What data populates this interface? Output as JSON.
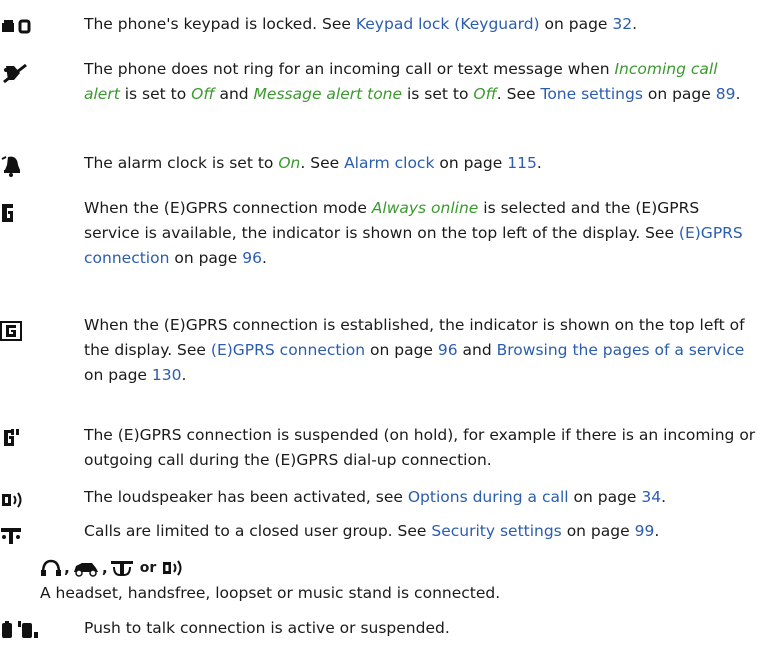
{
  "entries": [
    {
      "icon": "keypad-lock-icon",
      "parts": [
        {
          "t": "The phone's keypad is locked. See "
        },
        {
          "t": "Keypad lock (Keyguard)",
          "s": "link"
        },
        {
          "t": " on page "
        },
        {
          "t": "32",
          "s": "link"
        },
        {
          "t": "."
        }
      ]
    },
    {
      "icon": "silent-mode-icon",
      "parts": [
        {
          "t": "The phone does not ring for an incoming call or text message when "
        },
        {
          "t": "Incoming call alert",
          "s": "em"
        },
        {
          "t": " is set to "
        },
        {
          "t": "Off",
          "s": "em"
        },
        {
          "t": " and "
        },
        {
          "t": "Message alert tone",
          "s": "em"
        },
        {
          "t": " is set to "
        },
        {
          "t": "Off",
          "s": "em"
        },
        {
          "t": ". See "
        },
        {
          "t": "Tone settings",
          "s": "link"
        },
        {
          "t": " on page "
        },
        {
          "t": "89",
          "s": "link"
        },
        {
          "t": "."
        }
      ]
    },
    {
      "icon": "alarm-clock-icon",
      "parts": [
        {
          "t": "The alarm clock is set to "
        },
        {
          "t": "On",
          "s": "em"
        },
        {
          "t": ". See "
        },
        {
          "t": "Alarm clock",
          "s": "link"
        },
        {
          "t": " on page "
        },
        {
          "t": "115",
          "s": "link"
        },
        {
          "t": "."
        }
      ]
    },
    {
      "icon": "egprs-available-icon",
      "parts": [
        {
          "t": "When the (E)GPRS connection mode "
        },
        {
          "t": "Always online",
          "s": "em"
        },
        {
          "t": " is selected and the (E)GPRS service is available, the indicator is shown on the top left of the display. See "
        },
        {
          "t": "(E)GPRS connection",
          "s": "link"
        },
        {
          "t": " on page "
        },
        {
          "t": "96",
          "s": "link"
        },
        {
          "t": "."
        }
      ]
    },
    {
      "icon": "egprs-connected-icon",
      "parts": [
        {
          "t": "When the (E)GPRS connection is established, the indicator is shown on the top left of the display. See "
        },
        {
          "t": "(E)GPRS connection",
          "s": "link"
        },
        {
          "t": " on page "
        },
        {
          "t": "96",
          "s": "link"
        },
        {
          "t": " and "
        },
        {
          "t": "Browsing the pages of a service",
          "s": "link"
        },
        {
          "t": " on page "
        },
        {
          "t": "130",
          "s": "link"
        },
        {
          "t": "."
        }
      ]
    },
    {
      "icon": "egprs-suspended-icon",
      "parts": [
        {
          "t": "The (E)GPRS connection is suspended (on hold), for example if there is an incoming or outgoing call during the (E)GPRS dial-up connection."
        }
      ]
    },
    {
      "icon": "loudspeaker-icon",
      "parts": [
        {
          "t": "The loudspeaker has been activated, see "
        },
        {
          "t": "Options during a call",
          "s": "link"
        },
        {
          "t": " on page "
        },
        {
          "t": "34",
          "s": "link"
        },
        {
          "t": "."
        }
      ]
    },
    {
      "icon": "closed-user-group-icon",
      "parts": [
        {
          "t": "Calls are limited to a closed user group. See "
        },
        {
          "t": "Security settings",
          "s": "link"
        },
        {
          "t": " on page "
        },
        {
          "t": "99",
          "s": "link"
        },
        {
          "t": "."
        }
      ]
    },
    {
      "icon": "accessory-icons",
      "or_word": "or",
      "parts": [
        {
          "t": "A headset, handsfree, loopset or music stand is connected."
        }
      ]
    },
    {
      "icon": "push-to-talk-icon",
      "parts": [
        {
          "t": "Push to talk connection is active or suspended."
        }
      ]
    }
  ]
}
